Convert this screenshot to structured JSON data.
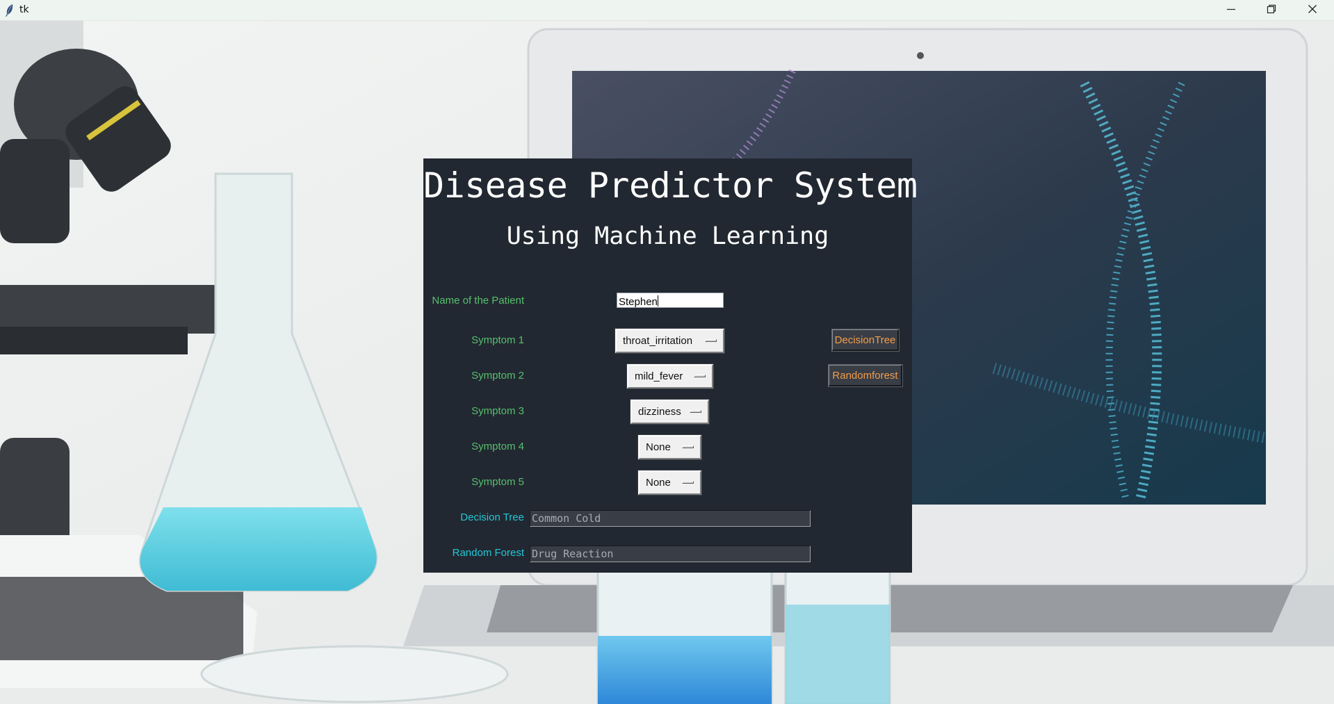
{
  "window": {
    "title": "tk",
    "controls": {
      "minimize": "minimize-icon",
      "maximize": "restore-icon",
      "close": "close-icon"
    }
  },
  "background": {
    "panel_color": "#222831",
    "label_color": "#55c06d",
    "result_label_color": "#22c7d6",
    "button_text_color": "#f39c4a"
  },
  "header": {
    "title": "Disease Predictor System",
    "subtitle": "Using Machine Learning"
  },
  "form": {
    "patient_label": "Name of the Patient",
    "patient_value": "Stephen",
    "symptoms": [
      {
        "label": "Symptom 1",
        "value": "throat_irritation"
      },
      {
        "label": "Symptom 2",
        "value": "mild_fever"
      },
      {
        "label": "Symptom 3",
        "value": "dizziness"
      },
      {
        "label": "Symptom 4",
        "value": "None"
      },
      {
        "label": "Symptom 5",
        "value": "None"
      }
    ]
  },
  "actions": {
    "decision_tree_button": "DecisionTree",
    "random_forest_button": "Randomforest"
  },
  "results": {
    "decision_tree_label": "Decision Tree",
    "decision_tree_value": "Common Cold",
    "random_forest_label": "Random Forest",
    "random_forest_value": "Drug Reaction"
  }
}
